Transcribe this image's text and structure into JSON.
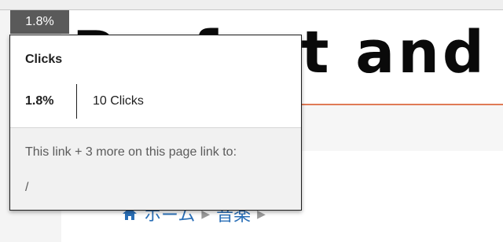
{
  "badge": {
    "percent": "1.8%"
  },
  "site": {
    "logo_text": "Perfect and Mu"
  },
  "breadcrumb": {
    "items": [
      "ホーム",
      "音楽"
    ]
  },
  "popup": {
    "title": "Clicks",
    "percent": "1.8%",
    "clicks": "10 Clicks",
    "description": "This link + 3 more on this page link to:",
    "target": "/"
  }
}
